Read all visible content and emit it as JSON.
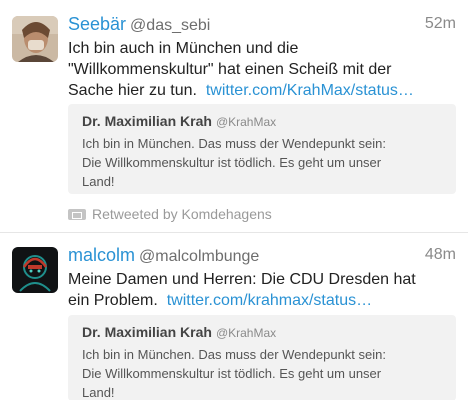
{
  "tweets": [
    {
      "name": "Seebär",
      "handle": "@das_sebi",
      "time": "52m",
      "text_lines": [
        "Ich bin auch in München und die",
        "\"Willkommenskultur\" hat einen Scheiß mit der",
        "Sache hier zu tun."
      ],
      "link": "twitter.com/KrahMax/status…",
      "quote": {
        "name": "Dr. Maximilian Krah",
        "handle": "@KrahMax",
        "text_lines": [
          "Ich bin in München. Das muss der Wendepunkt sein:",
          "Die Willkommenskultur ist tödlich. Es geht um unser",
          "Land!"
        ]
      },
      "retweeted_by": "Retweeted by Komdehagens"
    },
    {
      "name": "malcolm",
      "handle": "@malcolmbunge",
      "time": "48m",
      "text_lines": [
        "Meine Damen und Herren: Die CDU Dresden hat",
        "ein Problem."
      ],
      "link": "twitter.com/krahmax/status…",
      "quote": {
        "name": "Dr. Maximilian Krah",
        "handle": "@KrahMax",
        "text_lines": [
          "Ich bin in München. Das muss der Wendepunkt sein:",
          "Die Willkommenskultur ist tödlich. Es geht um unser",
          "Land!"
        ]
      }
    }
  ],
  "colors": {
    "accent": "#2a92d4",
    "quote_bg": "#f2f2f2",
    "muted": "#8a8a8a"
  },
  "icons": {
    "retweet": "retweet-icon"
  }
}
